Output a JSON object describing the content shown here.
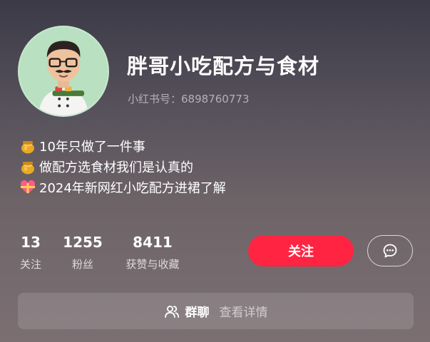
{
  "profile": {
    "nickname": "胖哥小吃配方与食材",
    "account_id": "小红书号：6898760773"
  },
  "bio": [
    {
      "icon": "honey-pot-icon",
      "text": "10年只做了一件事"
    },
    {
      "icon": "honey-pot-icon",
      "text": "做配方选食材我们是认真的"
    },
    {
      "icon": "heart-ribbon-icon",
      "text": "2024年新网红小吃配方进裙了解"
    }
  ],
  "stats": {
    "following": {
      "value": "13",
      "label": "关注"
    },
    "followers": {
      "value": "1255",
      "label": "粉丝"
    },
    "likes": {
      "value": "8411",
      "label": "获赞与收藏"
    }
  },
  "actions": {
    "follow_label": "关注",
    "message_icon": "chat-bubble-icon"
  },
  "group_chat": {
    "icon": "group-users-icon",
    "title": "群聊",
    "detail": "查看详情"
  },
  "colors": {
    "accent": "#ff2442",
    "avatar_bg": "#b9e0c0"
  }
}
